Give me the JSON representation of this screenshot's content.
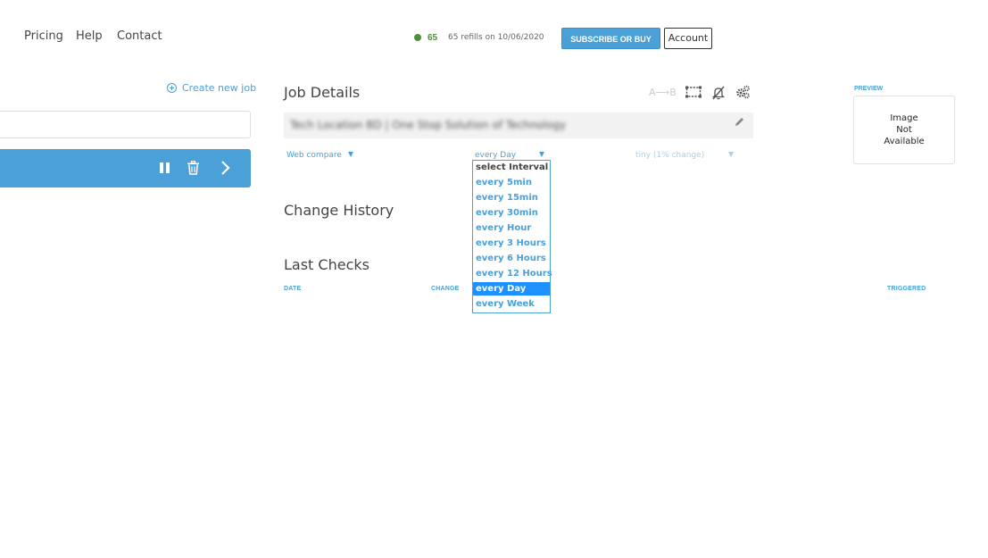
{
  "nav": {
    "links": [
      "Pricing",
      "Help",
      "Contact"
    ]
  },
  "credits": {
    "count": "65",
    "refill_text": "65 refills on 10/06/2020",
    "status_color": "#4e8f3a"
  },
  "header": {
    "subscribe_label": "SUBSCRIBE OR BUY",
    "account_label": "Account"
  },
  "sidebar": {
    "create_job_label": "Create new job",
    "search_value": ""
  },
  "job": {
    "title": "Job Details",
    "url_text": "Tech Location BD | One Stop Solution of Technology",
    "compare_type": "Web compare",
    "interval_value": "every Day",
    "threshold_value": "tiny (1% change)",
    "compare_ab_label": "A⟶B",
    "interval_options": [
      "select Interval",
      "every 5min",
      "every 15min",
      "every 30min",
      "every Hour",
      "every 3 Hours",
      "every 6 Hours",
      "every 12 Hours",
      "every Day",
      "every Week"
    ],
    "selected_interval_index": 8
  },
  "change_history": {
    "title": "Change History"
  },
  "last_checks": {
    "title": "Last Checks",
    "columns": {
      "date": "DATE",
      "change": "CHANGE",
      "triggered": "TRIGGERED"
    }
  },
  "preview": {
    "label": "PREVIEW",
    "placeholder_text": "Image\nNot\nAvailable"
  },
  "colors": {
    "accent": "#4ba0d8",
    "selected": "#1e90ff"
  }
}
